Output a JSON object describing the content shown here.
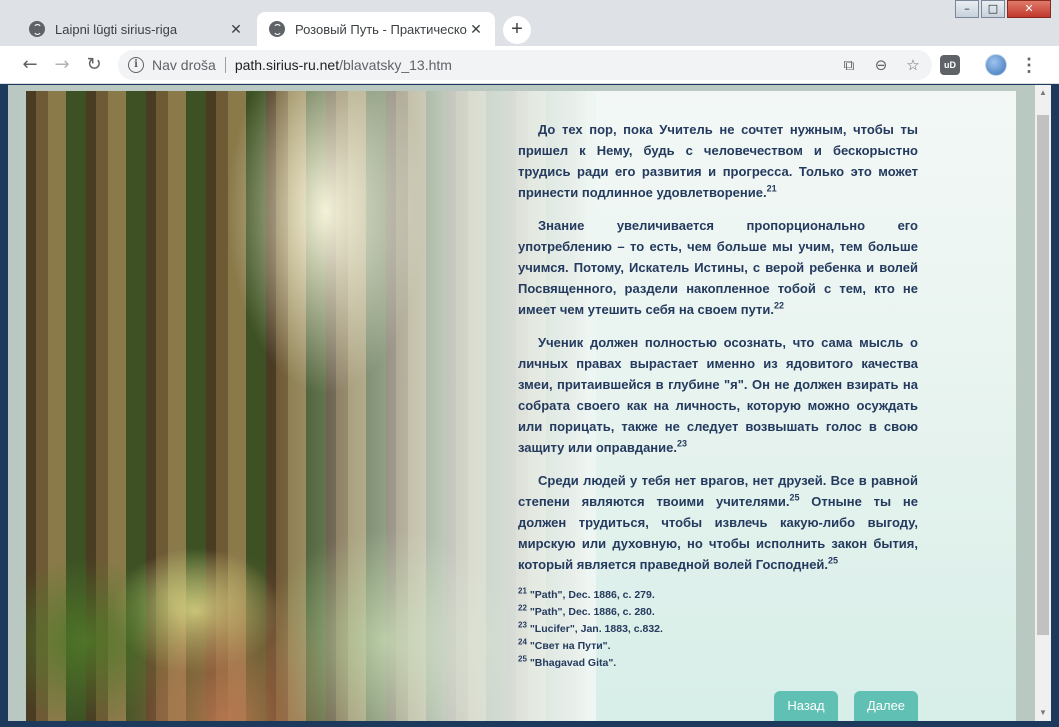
{
  "desktop": {
    "icons": [
      "",
      "",
      ""
    ]
  },
  "browser": {
    "tabs": [
      {
        "title": "Laipni lūgti sirius-riga",
        "active": false
      },
      {
        "title": "Розовый Путь - Практическое с",
        "active": true
      }
    ],
    "new_tab": "+",
    "window_controls": {
      "minimize": "–",
      "maximize": "□",
      "close": "✕"
    },
    "omnibox": {
      "security_label": "Nav droša",
      "host": "path.sirius-ru.net",
      "path": "/blavatsky_13.htm"
    },
    "extension_label": "uD"
  },
  "page": {
    "paragraphs": [
      {
        "text": "До тех пор, пока Учитель не сочтет нужным, чтобы ты пришел к Нему, будь с человечеством и бескорыстно трудись ради его развития и прогресса. Только это может принести подлинное удовлетворение.",
        "ref": "21"
      },
      {
        "text": "Знание увеличивается пропорционально его употреблению – то есть, чем больше мы учим, тем больше учимся. Потому, Искатель Истины, с верой ребенка и волей Посвященного, раздели накопленное тобой с тем, кто не имеет чем утешить себя на своем пути.",
        "ref": "22"
      },
      {
        "text": "Ученик должен полностью осознать, что сама мысль о личных правах вырастает именно из ядовитого качества змеи, притаившейся в глубине \"я\". Он не должен взирать на собрата своего как на личность, которую можно осуждать или порицать, также не следует возвышать голос в свою защиту или оправдание.",
        "ref": "23"
      },
      {
        "text_a": "Среди людей у тебя нет врагов, нет друзей. Все в равной степени являются твоими учителями.",
        "ref_a": "25",
        "text_b": " Отныне ты не должен трудиться, чтобы извлечь какую-либо выгоду, мирскую или духовную, но чтобы исполнить закон бытия, который является праведной волей Господней.",
        "ref_b": "25"
      }
    ],
    "footnotes": [
      {
        "num": "21",
        "text": "\"Path\", Dec. 1886, c. 279."
      },
      {
        "num": "22",
        "text": "\"Path\", Dec. 1886, c. 280."
      },
      {
        "num": "23",
        "text": "\"Lucifer\", Jan. 1883, c.832."
      },
      {
        "num": "24",
        "text": "\"Свет на Пути\"."
      },
      {
        "num": "25",
        "text": "\"Bhagavad Gita\"."
      }
    ],
    "buttons": {
      "back": "Назад",
      "next": "Далее"
    }
  },
  "colors": {
    "text": "#243a5e",
    "button": "#5fc0b3",
    "tab_active": "#ffffff",
    "tab_bar": "#dee1e6"
  }
}
